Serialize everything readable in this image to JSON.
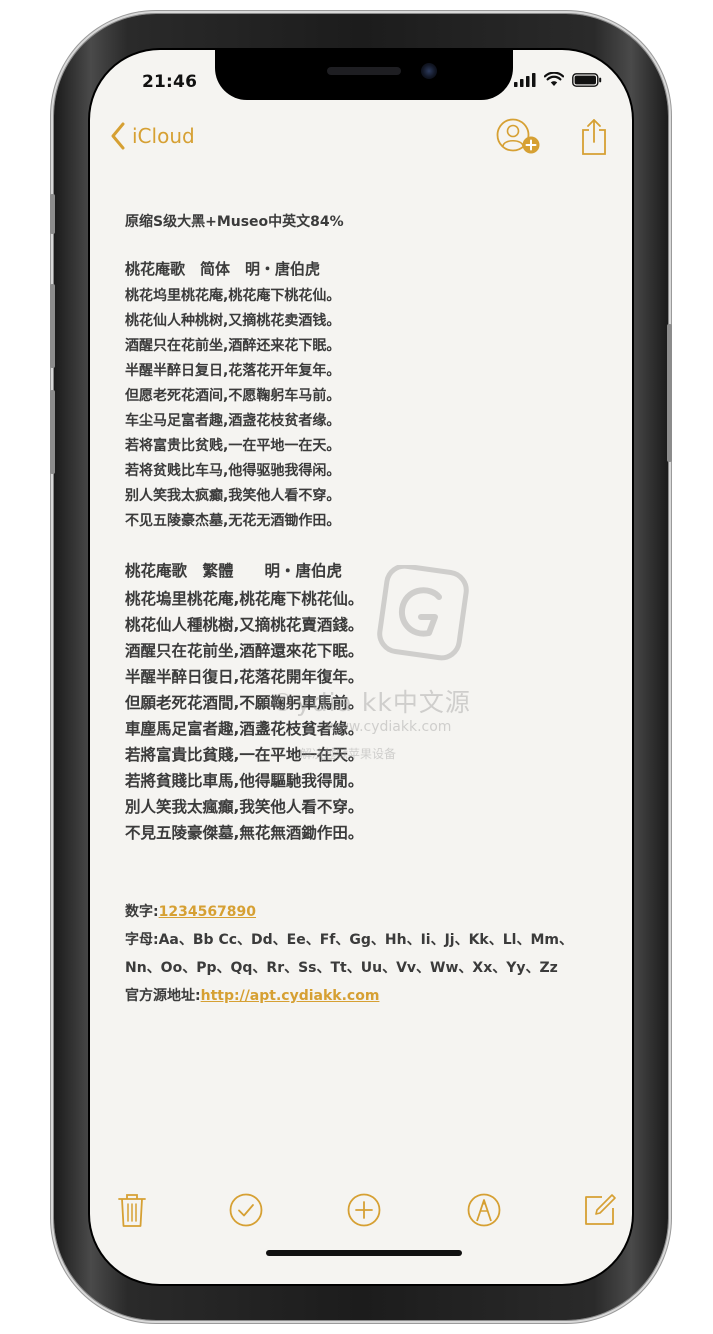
{
  "status_bar": {
    "time": "21:46"
  },
  "nav": {
    "back_label": "iCloud",
    "icons": [
      "chevron-left-icon",
      "add-people-icon",
      "share-icon"
    ]
  },
  "note": {
    "title": "原缩S级大黑+Museo中英文84%",
    "poem_simplified": {
      "heading": "桃花庵歌　简体　明・唐伯虎",
      "lines": [
        "桃花坞里桃花庵,桃花庵下桃花仙。",
        "桃花仙人种桃树,又摘桃花卖酒钱。",
        "酒醒只在花前坐,酒醉还来花下眠。",
        "半醒半醉日复日,花落花开年复年。",
        "但愿老死花酒间,不愿鞠躬车马前。",
        "车尘马足富者趣,酒盏花枝贫者缘。",
        "若将富贵比贫贱,一在平地一在天。",
        "若将贫贱比车马,他得驱驰我得闲。",
        "别人笑我太疯癫,我笑他人看不穿。",
        "不见五陵豪杰墓,无花无酒锄作田。"
      ]
    },
    "poem_traditional": {
      "heading": "桃花庵歌　繁體　　明・唐伯虎",
      "lines": [
        "桃花塢里桃花庵,桃花庵下桃花仙。",
        "桃花仙人種桃樹,又摘桃花賣酒錢。",
        "酒醒只在花前坐,酒醉還來花下眠。",
        "半醒半醉日復日,花落花開年復年。",
        "但願老死花酒間,不願鞠躬車馬前。",
        "車塵馬足富者趣,酒盞花枝貧者緣。",
        "若將富貴比貧賤,一在平地一在天。",
        "若將貧賤比車馬,他得驅馳我得閒。",
        "別人笑我太瘋癲,我笑他人看不穿。",
        "不見五陵豪傑墓,無花無酒鋤作田。"
      ]
    },
    "digits_label": "数字:",
    "digits_value": "1234567890",
    "letters_line1": "字母:Aa、Bb Cc、Dd、Ee、Ff、Gg、Hh、Ii、Jj、Kk、Ll、Mm、",
    "letters_line2": "Nn、Oo、Pp、Qq、Rr、Ss、Tt、Uu、Vv、Ww、Xx、Yy、Zz",
    "source_label": "官方源地址:",
    "source_url": "http://apt.cydiakk.com"
  },
  "watermark": {
    "big_text": "©ydia kk中文源",
    "url_text": "www.cydiakk.com",
    "small_text": "解决越狱苹果设备"
  },
  "toolbar": {
    "icons": [
      "trash-icon",
      "checklist-icon",
      "add-icon",
      "markup-icon",
      "compose-icon"
    ]
  },
  "colors": {
    "accent": "#d6a033",
    "text": "#3b3b3b",
    "paper": "#f5f4f1"
  }
}
